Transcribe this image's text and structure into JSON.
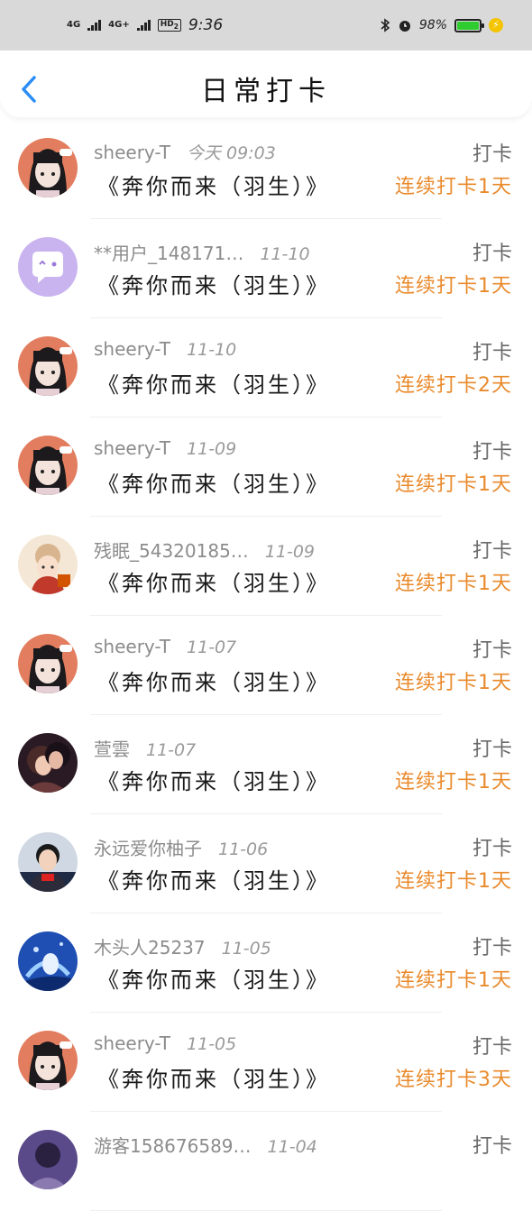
{
  "status": {
    "sig1": "4G",
    "sig2": "4G+",
    "hd": "HD",
    "hd_sub": "2",
    "time": "9:36",
    "battery": "98%"
  },
  "header": {
    "title": "日常打卡"
  },
  "rows": [
    {
      "user": "sheery-T",
      "date": "今天 09:03",
      "song": "《奔你而来（羽生）》",
      "kind": "打卡",
      "streak": "连续打卡1天",
      "avatar": "girl-avatar"
    },
    {
      "user": "**用户_148171…",
      "date": "11-10",
      "song": "《奔你而来（羽生）》",
      "kind": "打卡",
      "streak": "连续打卡1天",
      "avatar": "chat-bubble-avatar"
    },
    {
      "user": "sheery-T",
      "date": "11-10",
      "song": "《奔你而来（羽生）》",
      "kind": "打卡",
      "streak": "连续打卡2天",
      "avatar": "girl-avatar"
    },
    {
      "user": "sheery-T",
      "date": "11-09",
      "song": "《奔你而来（羽生）》",
      "kind": "打卡",
      "streak": "连续打卡1天",
      "avatar": "girl-avatar"
    },
    {
      "user": "残眠_54320185…",
      "date": "11-09",
      "song": "《奔你而来（羽生）》",
      "kind": "打卡",
      "streak": "连续打卡1天",
      "avatar": "winter-girl-avatar"
    },
    {
      "user": "sheery-T",
      "date": "11-07",
      "song": "《奔你而来（羽生）》",
      "kind": "打卡",
      "streak": "连续打卡1天",
      "avatar": "girl-avatar"
    },
    {
      "user": "萱雲",
      "date": "11-07",
      "song": "《奔你而来（羽生）》",
      "kind": "打卡",
      "streak": "连续打卡1天",
      "avatar": "couple-avatar"
    },
    {
      "user": "永远爱你柚子",
      "date": "11-06",
      "song": "《奔你而来（羽生）》",
      "kind": "打卡",
      "streak": "连续打卡1天",
      "avatar": "skater-avatar"
    },
    {
      "user": "木头人25237",
      "date": "11-05",
      "song": "《奔你而来（羽生）》",
      "kind": "打卡",
      "streak": "连续打卡1天",
      "avatar": "blue-art-avatar"
    },
    {
      "user": "sheery-T",
      "date": "11-05",
      "song": "《奔你而来（羽生）》",
      "kind": "打卡",
      "streak": "连续打卡3天",
      "avatar": "girl-avatar"
    },
    {
      "user": "游客158676589…",
      "date": "11-04",
      "song": "",
      "kind": "打卡",
      "streak": "",
      "avatar": "purple-avatar"
    }
  ]
}
